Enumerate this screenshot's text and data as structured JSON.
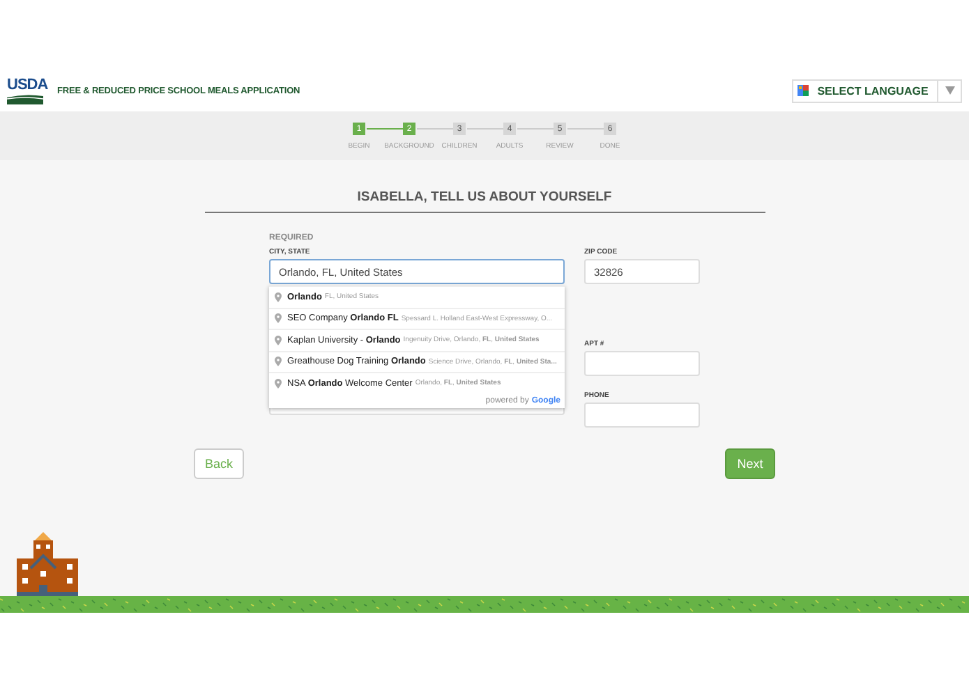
{
  "header": {
    "logo": "USDA",
    "title": "FREE & REDUCED PRICE SCHOOL MEALS APPLICATION",
    "language_select": "SELECT LANGUAGE"
  },
  "steps": [
    {
      "number": "1",
      "label": "BEGIN",
      "completed": true
    },
    {
      "number": "2",
      "label": "BACKGROUND",
      "completed": true
    },
    {
      "number": "3",
      "label": "CHILDREN",
      "completed": false
    },
    {
      "number": "4",
      "label": "ADULTS",
      "completed": false
    },
    {
      "number": "5",
      "label": "REVIEW",
      "completed": false
    },
    {
      "number": "6",
      "label": "DONE",
      "completed": false
    }
  ],
  "form": {
    "heading": "ISABELLA, TELL US ABOUT YOURSELF",
    "section": "REQUIRED",
    "city": {
      "label": "CITY, STATE",
      "value": "Orlando, FL, United States"
    },
    "zip": {
      "label": "ZIP CODE",
      "value": "32826"
    },
    "apt": {
      "label": "APT #"
    },
    "phone": {
      "label": "PHONE"
    },
    "suggestions": [
      {
        "main": "**Orlando**",
        "detail": "FL, United States"
      },
      {
        "main": "SEO Company **Orlando FL**",
        "detail": "Spessard L. Holland East-West Expressway, O..."
      },
      {
        "main": "Kaplan University - **Orlando**",
        "detail": "Ingenuity Drive, Orlando, **FL**, **United States**"
      },
      {
        "main": "Greathouse Dog Training **Orlando**",
        "detail": "Science Drive, Orlando, **FL**, **United Sta...**"
      },
      {
        "main": "NSA **Orlando** Welcome Center",
        "detail": "Orlando, **FL**, **United States**"
      }
    ],
    "attribution": "powered by",
    "attribution_brand": "Google"
  },
  "buttons": {
    "back": "Back",
    "next": "Next"
  }
}
